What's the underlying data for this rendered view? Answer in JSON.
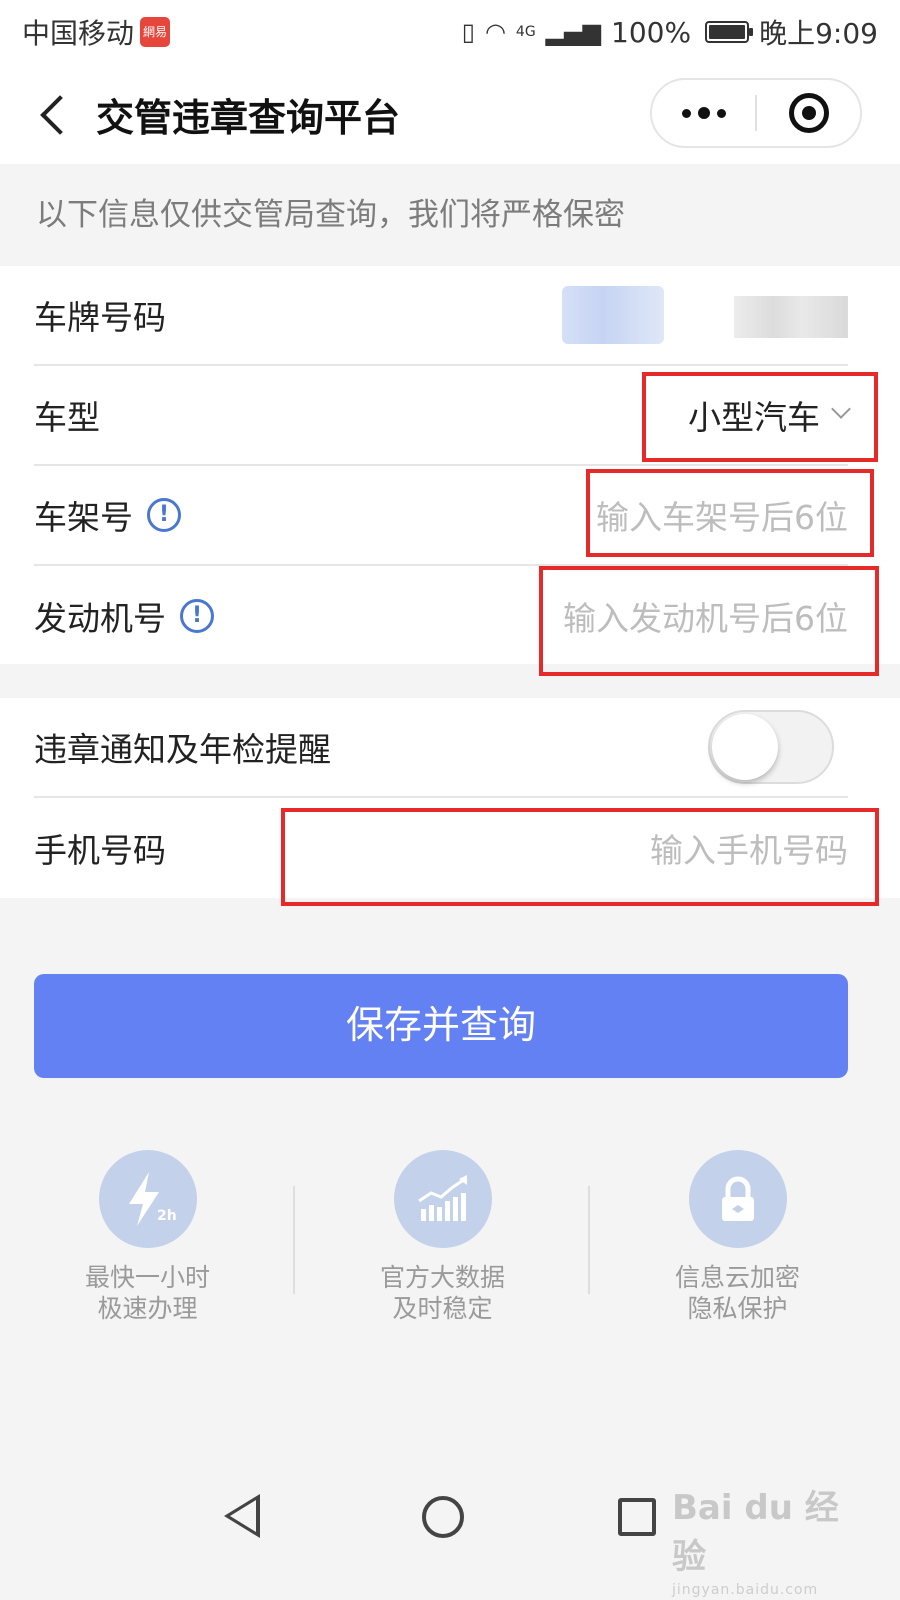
{
  "status_bar": {
    "carrier": "中国移动",
    "carrier_badge": "網易",
    "network": "4G",
    "battery": "100%",
    "time": "晚上9:09"
  },
  "nav": {
    "title": "交管违章查询平台"
  },
  "notice": "以下信息仅供交管局查询，我们将严格保密",
  "form": {
    "plate": {
      "label": "车牌号码"
    },
    "vehicle_type": {
      "label": "车型",
      "value": "小型汽车"
    },
    "vin": {
      "label": "车架号",
      "placeholder": "输入车架号后6位"
    },
    "engine": {
      "label": "发动机号",
      "placeholder": "输入发动机号后6位"
    },
    "notify": {
      "label": "违章通知及年检提醒",
      "enabled": false
    },
    "phone": {
      "label": "手机号码",
      "placeholder": "输入手机号码"
    }
  },
  "submit_label": "保存并查询",
  "features": [
    {
      "icon": "lightning-2h-icon",
      "badge": "2h",
      "line1": "最快一小时",
      "line2": "极速办理"
    },
    {
      "icon": "bar-chart-trend-icon",
      "line1": "官方大数据",
      "line2": "及时稳定"
    },
    {
      "icon": "padlock-icon",
      "line1": "信息云加密",
      "line2": "隐私保护"
    }
  ],
  "watermark": {
    "brand": "Bai du 经验",
    "url": "jingyan.baidu.com"
  },
  "colors": {
    "primary": "#6381f2",
    "annotation": "#e62a2a",
    "info": "#4a78d0",
    "feature_circle": "#c3d2ea"
  }
}
